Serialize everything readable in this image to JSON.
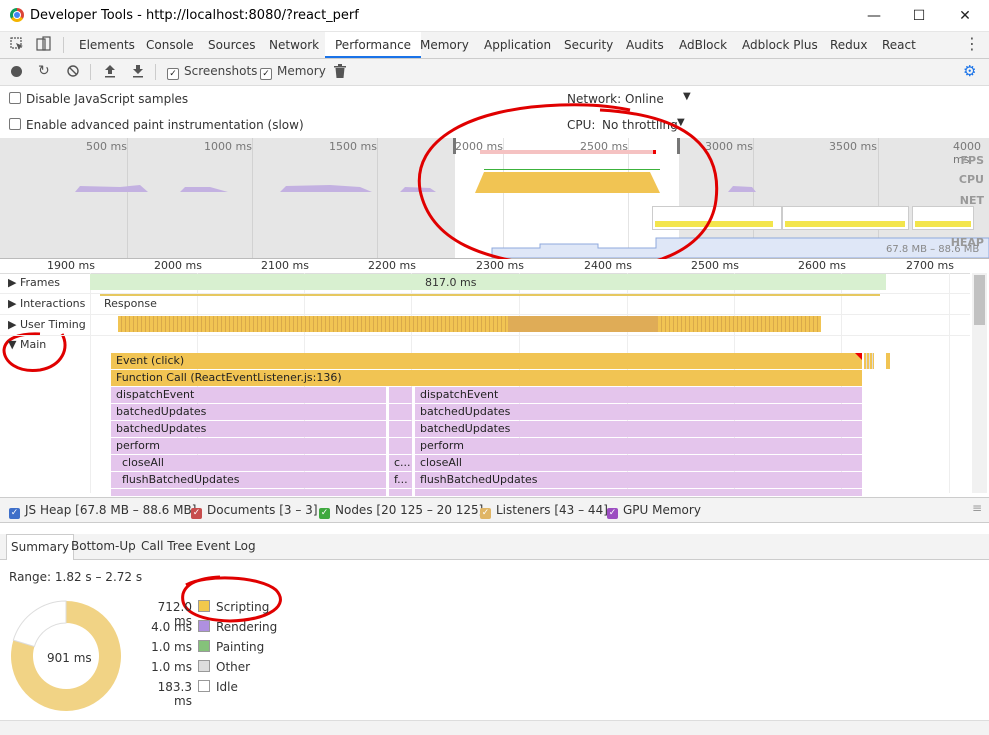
{
  "window": {
    "title": "Developer Tools - http://localhost:8080/?react_perf",
    "minimize": "—",
    "maximize": "☐",
    "close": "✕"
  },
  "tabs": [
    "Elements",
    "Console",
    "Sources",
    "Network",
    "Performance",
    "Memory",
    "Application",
    "Security",
    "Audits",
    "AdBlock",
    "Adblock Plus",
    "Redux",
    "React"
  ],
  "active_tab": "Performance",
  "toolbar": {
    "screenshots": "Screenshots",
    "memory": "Memory"
  },
  "settings": {
    "disable_js_samples": "Disable JavaScript samples",
    "advanced_paint": "Enable advanced paint instrumentation (slow)",
    "network_label": "Network:",
    "network_value": "Online",
    "cpu_label": "CPU:",
    "cpu_value": "No throttling"
  },
  "overview": {
    "ticks": [
      "500 ms",
      "1000 ms",
      "1500 ms",
      "2000 ms",
      "2500 ms",
      "3000 ms",
      "3500 ms",
      "4000 ms"
    ],
    "labels": {
      "fps": "FPS",
      "cpu": "CPU",
      "net": "NET",
      "heap": "HEAP"
    },
    "heap_range": "67.8 MB – 88.6 MB"
  },
  "ruler_ticks": [
    "1900 ms",
    "2000 ms",
    "2100 ms",
    "2200 ms",
    "2300 ms",
    "2400 ms",
    "2500 ms",
    "2600 ms",
    "2700 ms"
  ],
  "tracks": {
    "frames": "Frames",
    "frames_value": "817.0 ms",
    "interactions": "Interactions",
    "response": "Response",
    "user_timing": "User Timing",
    "main": "Main"
  },
  "flame": {
    "event": "Event (click)",
    "function_call": "Function Call (ReactEventListener.js:136)",
    "left": [
      "dispatchEvent",
      "batchedUpdates",
      "batchedUpdates",
      "perform",
      "closeAll",
      "flushBatchedUpdates"
    ],
    "mid": [
      "",
      "",
      "",
      "",
      "c...",
      "f..."
    ],
    "right": [
      "dispatchEvent",
      "batchedUpdates",
      "batchedUpdates",
      "perform",
      "closeAll",
      "flushBatchedUpdates"
    ]
  },
  "legend": {
    "js_heap": "JS Heap [67.8 MB – 88.6 MB]",
    "documents": "Documents [3 – 3]",
    "nodes": "Nodes [20 125 – 20 125]",
    "listeners": "Listeners [43 – 44]",
    "gpu": "GPU Memory"
  },
  "bottom_tabs": [
    "Summary",
    "Bottom-Up",
    "Call Tree",
    "Event Log"
  ],
  "summary": {
    "range": "Range: 1.82 s – 2.72 s",
    "total": "901 ms",
    "rows": [
      {
        "value": "712.0 ms",
        "label": "Scripting",
        "color": "#f2c94c"
      },
      {
        "value": "4.0 ms",
        "label": "Rendering",
        "color": "#af90e0"
      },
      {
        "value": "1.0 ms",
        "label": "Painting",
        "color": "#85c27a"
      },
      {
        "value": "1.0 ms",
        "label": "Other",
        "color": "#dddddd"
      },
      {
        "value": "183.3 ms",
        "label": "Idle",
        "color": "#ffffff"
      }
    ]
  },
  "colors": {
    "accent": "#1a73e8",
    "scripting": "#f1c453",
    "flame_purple": "#e4c5ec",
    "annotation": "#e00000"
  }
}
